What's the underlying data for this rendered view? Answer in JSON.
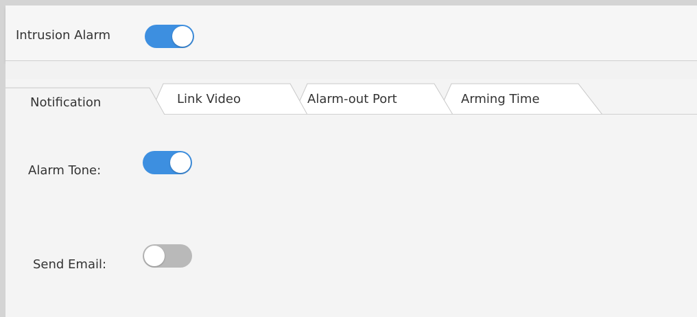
{
  "header": {
    "title": "Intrusion Alarm",
    "enabled": true
  },
  "tabs": [
    {
      "label": "Notification",
      "active": true
    },
    {
      "label": "Link Video",
      "active": false
    },
    {
      "label": "Alarm-out Port",
      "active": false
    },
    {
      "label": "Arming Time",
      "active": false
    }
  ],
  "notification": {
    "alarm_tone": {
      "label": "Alarm Tone:",
      "enabled": true
    },
    "send_email": {
      "label": "Send Email:",
      "enabled": false
    }
  },
  "colors": {
    "toggle_on": "#3d8fe0",
    "toggle_off": "#b9b9b9"
  }
}
